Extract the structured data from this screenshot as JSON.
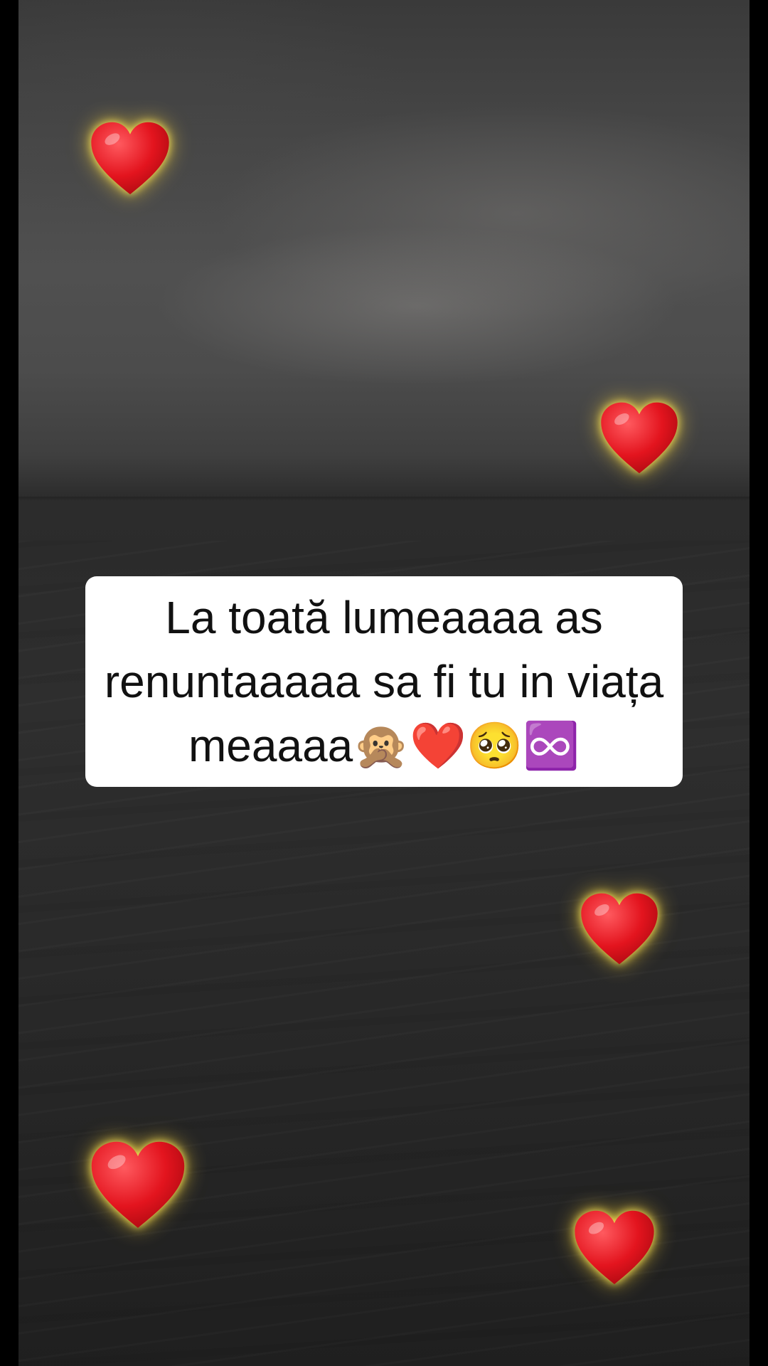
{
  "overlay": {
    "caption": "La toată lumeaaaa as renuntaaaaa sa fi tu in viața meaaaa🙊❤️🥺♾️"
  },
  "decorations": {
    "heart_icon": "heart-icon",
    "heart_color": "#e3141e",
    "glow_color": "#ffe45a"
  }
}
